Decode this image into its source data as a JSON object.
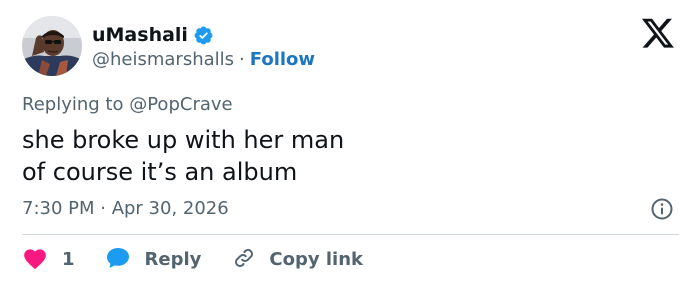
{
  "author": {
    "display_name": "uMashali",
    "handle": "@heismarshalls",
    "separator": "·",
    "follow_label": "Follow",
    "verified": true
  },
  "tweet": {
    "replying_prefix": "Replying to",
    "replying_to": "@PopCrave",
    "lines": [
      "she broke up with her man",
      "of course it’s an album"
    ],
    "timestamp": "7:30 PM · Apr 30, 2026"
  },
  "actions": {
    "like_count": "1",
    "reply_label": "Reply",
    "copy_label": "Copy link"
  },
  "icons": {
    "logo": "x-logo-icon",
    "verified": "verified-badge-icon",
    "info": "info-icon",
    "like": "heart-icon",
    "reply": "speech-bubble-icon",
    "copy": "link-icon"
  },
  "colors": {
    "accent": "#1d9bf0",
    "follow": "#1d76c2",
    "like": "#f91880",
    "secondary_text": "#536471",
    "primary_text": "#0f1419",
    "divider": "#cfd9de"
  }
}
